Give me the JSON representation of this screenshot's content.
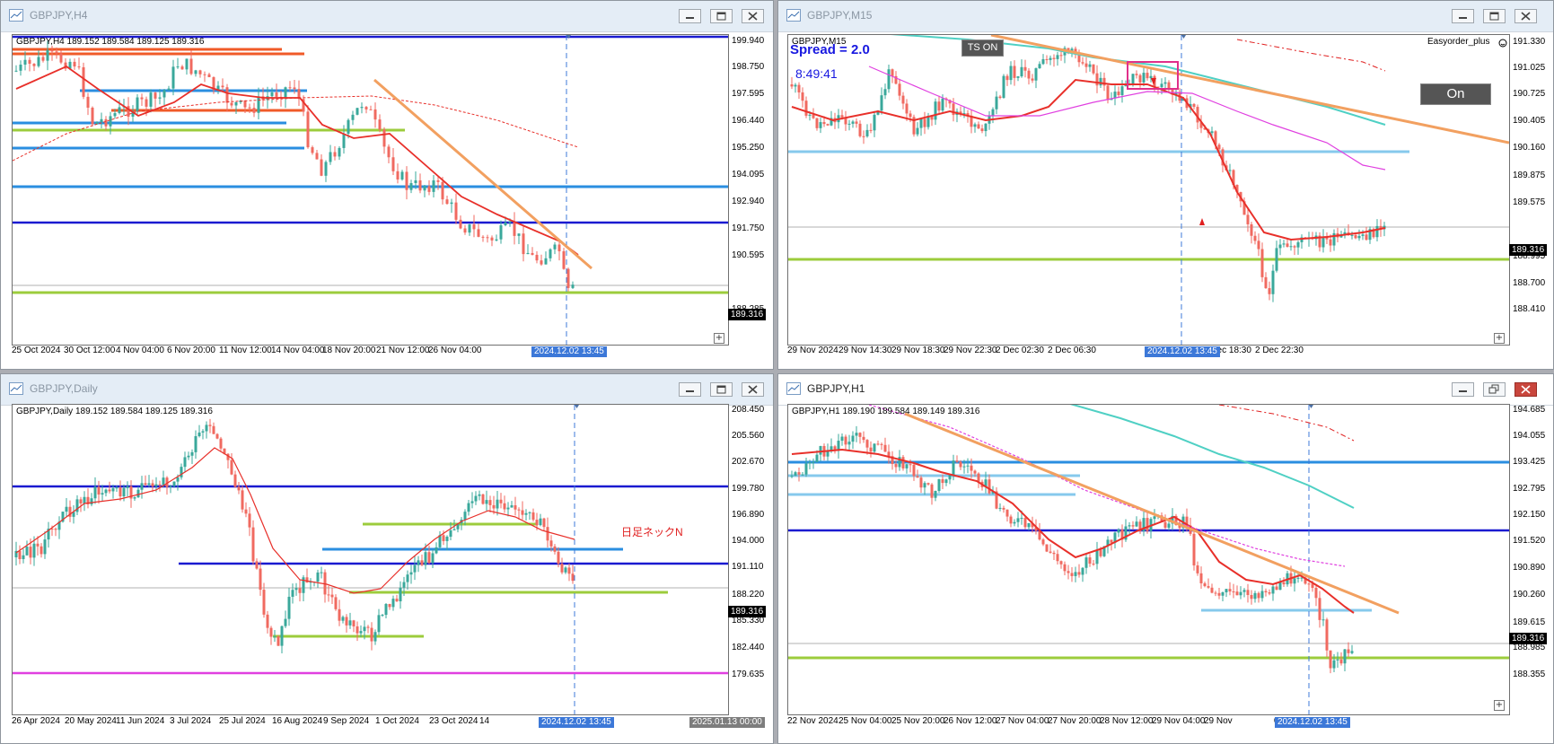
{
  "windows": {
    "h4": {
      "title": "GBPJPY,H4",
      "symbol_line": "GBPJPY,H4  189.152 189.584 189.125 189.316",
      "y_ticks": [
        "199.940",
        "198.750",
        "197.595",
        "196.440",
        "195.250",
        "194.095",
        "192.940",
        "191.750",
        "190.595",
        "189.316",
        "188.285"
      ],
      "x_ticks": [
        "25 Oct 2024",
        "30 Oct 12:00",
        "4 Nov 04:00",
        "6 Nov 20:00",
        "11 Nov 12:00",
        "14 Nov 04:00",
        "18 Nov 20:00",
        "21 Nov 12:00",
        "26 Nov 04:00"
      ],
      "date_badge": "2024.12.02 13:45",
      "price_badge": "189.316"
    },
    "m15": {
      "title": "GBPJPY,M15",
      "symbol_line": "GBPJPY,M15",
      "spread": "Spread = 2.0",
      "timer": "8:49:41",
      "ts_button": "TS ON",
      "ea_name": "Easyorder_plus",
      "on_button": "On",
      "y_ticks": [
        "191.330",
        "191.025",
        "190.725",
        "190.405",
        "190.160",
        "189.875",
        "189.575",
        "189.316",
        "188.995",
        "188.700",
        "188.410"
      ],
      "x_ticks": [
        "29 Nov 2024",
        "29 Nov 14:30",
        "29 Nov 18:30",
        "29 Nov 22:30",
        "2 Dec 02:30",
        "2 Dec 06:30",
        "2 Dec 14:30",
        "2 Dec 18:30",
        "2 Dec 22:30"
      ],
      "date_badge": "2024.12.02 13:45",
      "price_badge": "189.316"
    },
    "daily": {
      "title": "GBPJPY,Daily",
      "symbol_line": "GBPJPY,Daily  189.152 189.584 189.125 189.316",
      "annotation": "日足ネックN",
      "y_ticks": [
        "208.450",
        "205.560",
        "202.670",
        "199.780",
        "196.890",
        "194.000",
        "191.110",
        "189.316",
        "188.220",
        "185.330",
        "182.440",
        "179.635"
      ],
      "x_ticks": [
        "26 Apr 2024",
        "20 May 2024",
        "11 Jun 2024",
        "3 Jul 2024",
        "25 Jul 2024",
        "16 Aug 2024",
        "9 Sep 2024",
        "1 Oct 2024",
        "23 Oct 2024",
        "14"
      ],
      "date_badge": "2024.12.02 13:45",
      "date_badge2": "2025.01.13 00:00",
      "price_badge": "189.316"
    },
    "h1": {
      "title": "GBPJPY,H1",
      "symbol_line": "GBPJPY,H1  189.190 189.584 189.149 189.316",
      "y_ticks": [
        "194.685",
        "194.055",
        "193.425",
        "192.795",
        "192.150",
        "191.520",
        "190.890",
        "190.260",
        "189.615",
        "189.316",
        "188.985",
        "188.355"
      ],
      "x_ticks": [
        "22 Nov 2024",
        "25 Nov 04:00",
        "25 Nov 20:00",
        "26 Nov 12:00",
        "27 Nov 04:00",
        "27 Nov 20:00",
        "28 Nov 12:00",
        "29 Nov 04:00",
        "29 Nov",
        "0"
      ],
      "date_badge": "2024.12.02 13:45",
      "price_badge": "189.316"
    }
  },
  "colors": {
    "bull": "#3aa89b",
    "bear": "#f06a60",
    "ma_red": "#e8302a",
    "trend_orange": "#f2a060",
    "navy": "#1a1ad0",
    "blue": "#2a8ee0",
    "lightblue": "#86c9ec",
    "green": "#9ccc3c",
    "teal": "#4fd0c4",
    "magenta": "#e040e0",
    "orange_red": "#f05a28"
  }
}
